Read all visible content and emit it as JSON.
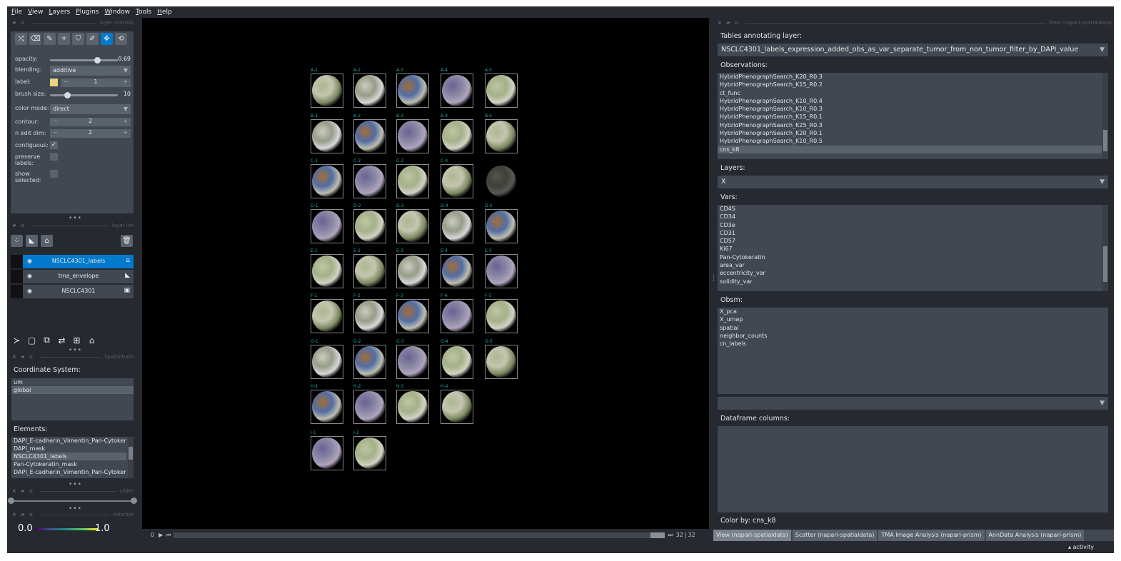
{
  "menu": [
    "File",
    "View",
    "Layers",
    "Plugins",
    "Window",
    "Tools",
    "Help"
  ],
  "docks": {
    "layer_controls_title": "layer controls",
    "layer_list_title": "layer list",
    "spatialdata_title": "SpatialData",
    "slider_title": "slider",
    "colorbar_title": "colorbar",
    "right_title": "View (napari-spatialdata)"
  },
  "layer_controls": {
    "tools": [
      "shuffle-icon",
      "eraser-icon",
      "paint-brush-icon",
      "polygon-icon",
      "fill-bucket-icon",
      "color-picker-icon",
      "pan-zoom-icon",
      "transform-icon"
    ],
    "opacity_label": "opacity:",
    "opacity_value": "0.69",
    "opacity_fraction": 0.69,
    "blending_label": "blending:",
    "blending_value": "additive",
    "label_label": "label:",
    "label_value": "1",
    "label_color": "#e5d580",
    "brush_size_label": "brush size:",
    "brush_size_value": "10",
    "brush_size_fraction": 0.25,
    "color_mode_label": "color mode:",
    "color_mode_value": "direct",
    "contour_label": "contour:",
    "contour_value": "2",
    "n_edit_dim_label": "n edit dim:",
    "n_edit_dim_value": "2",
    "contiguous_label": "contiguous:",
    "contiguous_checked": "✓",
    "preserve_labels_label": "preserve labels:",
    "show_selected_label": "show selected:"
  },
  "layers": [
    {
      "name": "NSCLC4301_labels",
      "type_icon": "labels-icon",
      "selected": true
    },
    {
      "name": "tma_envelope",
      "type_icon": "shapes-icon",
      "selected": false
    },
    {
      "name": "NSCLC4301",
      "type_icon": "image-icon",
      "selected": false
    }
  ],
  "spatialdata": {
    "coordinate_system_label": "Coordinate System:",
    "coordinate_systems": [
      "um",
      "global"
    ],
    "selected_coordinate_system": "global",
    "elements_label": "Elements:",
    "elements": [
      "DAPI_E-cadherin_Vimentin_Pan-Cytokerati",
      "DAPI_mask",
      "NSCLC4301_labels",
      "Pan-Cytokeratin_mask",
      "DAPI_E-cadherin_Vimentin_Pan-Cytokerati"
    ],
    "selected_element": "NSCLC4301_labels"
  },
  "colorbar": {
    "min": "0.0",
    "max": "1.0"
  },
  "canvas": {
    "cores": [
      {
        "label": "A-1"
      },
      {
        "label": "A-2"
      },
      {
        "label": "A-3"
      },
      {
        "label": "A-4"
      },
      {
        "label": "A-5"
      },
      {
        "label": "B-1"
      },
      {
        "label": "B-2"
      },
      {
        "label": "B-3"
      },
      {
        "label": "B-4"
      },
      {
        "label": "B-5"
      },
      {
        "label": "C-1"
      },
      {
        "label": "C-2"
      },
      {
        "label": "C-3"
      },
      {
        "label": "C-4"
      },
      {
        "label": ""
      },
      {
        "label": "D-1"
      },
      {
        "label": "D-2"
      },
      {
        "label": "D-3"
      },
      {
        "label": "D-4"
      },
      {
        "label": "D-5"
      },
      {
        "label": "E-1"
      },
      {
        "label": "E-2"
      },
      {
        "label": "E-3"
      },
      {
        "label": "E-4"
      },
      {
        "label": "E-5"
      },
      {
        "label": "F-1"
      },
      {
        "label": "F-2"
      },
      {
        "label": "F-3"
      },
      {
        "label": "F-4"
      },
      {
        "label": "F-5"
      },
      {
        "label": "G-1"
      },
      {
        "label": "G-2"
      },
      {
        "label": "G-3"
      },
      {
        "label": "G-4"
      },
      {
        "label": "G-5"
      },
      {
        "label": "H-1"
      },
      {
        "label": "H-2"
      },
      {
        "label": "H-3"
      },
      {
        "label": "H-4"
      },
      {
        "label": "I-1"
      },
      {
        "label": "I-2"
      }
    ]
  },
  "dims": {
    "start": "0",
    "current": "32",
    "total": "32"
  },
  "right_panel": {
    "tables_label": "Tables annotating layer:",
    "table_value": "NSCLC4301_labels_expression_added_obs_as_var_separate_tumor_from_non_tumor_filter_by_DAPI_value",
    "observations_label": "Observations:",
    "observations": [
      "HybridPhenographSearch_K20_R0.3",
      "HybridPhenographSearch_K15_R0.2",
      "ct_func",
      "HybridPhenographSearch_K10_R0.4",
      "HybridPhenographSearch_K10_R0.3",
      "HybridPhenographSearch_K15_R0.1",
      "HybridPhenographSearch_K25_R0.3",
      "HybridPhenographSearch_K20_R0.1",
      "HybridPhenographSearch_K10_R0.5",
      "cns_k8"
    ],
    "selected_observation": "cns_k8",
    "layers_label": "Layers:",
    "layers_value": "X",
    "vars_label": "Vars:",
    "vars": [
      "CD45",
      "CD34",
      "CD3e",
      "CD31",
      "CD57",
      "Ki67",
      "Pan-Cytokeratin",
      "area_var",
      "eccentricity_var",
      "solidity_var"
    ],
    "obsm_label": "Obsm:",
    "obsm": [
      "X_pca",
      "X_umap",
      "spatial",
      "neighbor_counts",
      "cn_labels"
    ],
    "extra_combo_value": "",
    "dataframe_columns_label": "Dataframe columns:",
    "color_by": "Color by: cns_k8"
  },
  "tabs": [
    "View (napari-spatialdata)",
    "Scatter (napari-spatialdata)",
    "TMA Image Analysis (napari-prism)",
    "AnnData Analysis (napari-prism)"
  ],
  "active_tab": "View (napari-spatialdata)",
  "status": {
    "activity": "▴ activity"
  }
}
